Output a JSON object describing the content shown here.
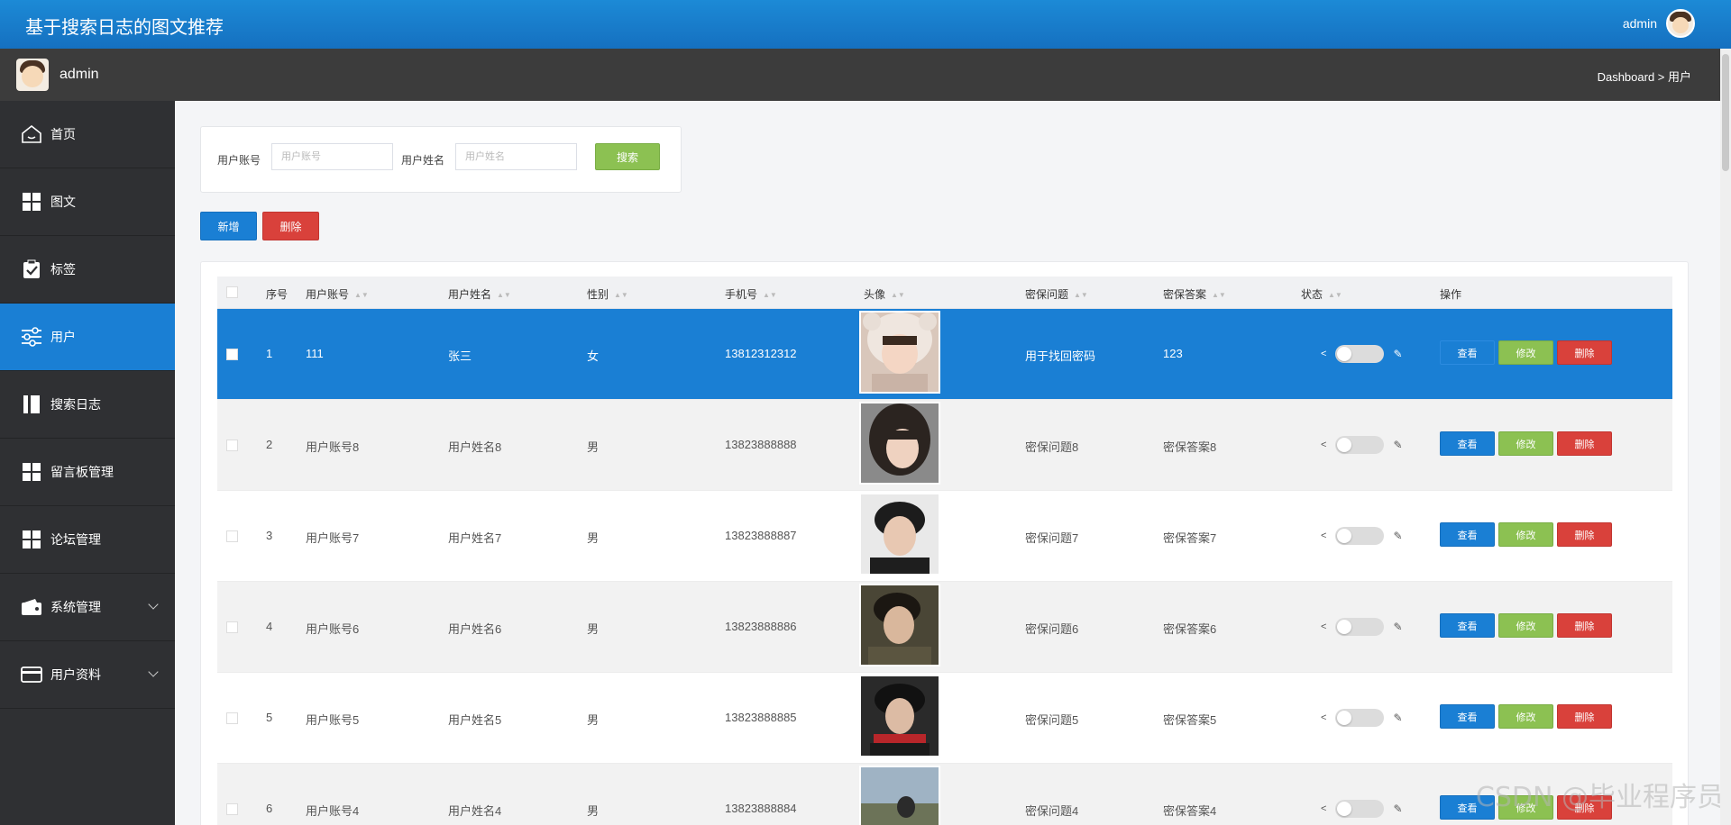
{
  "app": {
    "title": "基于搜索日志的图文推荐",
    "top_user": "admin"
  },
  "subbar": {
    "user": "admin",
    "breadcrumb": "Dashboard > 用户"
  },
  "sidebar": {
    "items": [
      {
        "label": "首页",
        "icon": "home-icon"
      },
      {
        "label": "图文",
        "icon": "grid-icon"
      },
      {
        "label": "标签",
        "icon": "clipboard-check-icon"
      },
      {
        "label": "用户",
        "icon": "sliders-icon",
        "active": true
      },
      {
        "label": "搜索日志",
        "icon": "book-icon"
      },
      {
        "label": "留言板管理",
        "icon": "grid-icon"
      },
      {
        "label": "论坛管理",
        "icon": "grid-icon"
      },
      {
        "label": "系统管理",
        "icon": "wallet-icon",
        "expandable": true
      },
      {
        "label": "用户资料",
        "icon": "card-icon",
        "expandable": true
      }
    ]
  },
  "search": {
    "account_label": "用户账号",
    "account_placeholder": "用户账号",
    "name_label": "用户姓名",
    "name_placeholder": "用户姓名",
    "button": "搜索"
  },
  "toolbar": {
    "add": "新增",
    "delete": "删除"
  },
  "table": {
    "columns": [
      "序号",
      "用户账号",
      "用户姓名",
      "性别",
      "手机号",
      "头像",
      "密保问题",
      "密保答案",
      "状态",
      "操作"
    ],
    "rows": [
      {
        "no": "1",
        "account": "111",
        "name": "张三",
        "gender": "女",
        "phone": "13812312312",
        "question": "用于找回密码",
        "answer": "123"
      },
      {
        "no": "2",
        "account": "用户账号8",
        "name": "用户姓名8",
        "gender": "男",
        "phone": "13823888888",
        "question": "密保问题8",
        "answer": "密保答案8"
      },
      {
        "no": "3",
        "account": "用户账号7",
        "name": "用户姓名7",
        "gender": "男",
        "phone": "13823888887",
        "question": "密保问题7",
        "answer": "密保答案7"
      },
      {
        "no": "4",
        "account": "用户账号6",
        "name": "用户姓名6",
        "gender": "男",
        "phone": "13823888886",
        "question": "密保问题6",
        "answer": "密保答案6"
      },
      {
        "no": "5",
        "account": "用户账号5",
        "name": "用户姓名5",
        "gender": "男",
        "phone": "13823888885",
        "question": "密保问题5",
        "answer": "密保答案5"
      },
      {
        "no": "6",
        "account": "用户账号4",
        "name": "用户姓名4",
        "gender": "男",
        "phone": "13823888884",
        "question": "密保问题4",
        "answer": "密保答案4"
      }
    ],
    "actions": {
      "view": "查看",
      "edit": "修改",
      "delete": "删除"
    }
  },
  "watermark": "CSDN @毕业程序员",
  "colors": {
    "primary": "#1a7fd4",
    "success": "#8cc152",
    "danger": "#d9413b",
    "sidebar": "#2f3033"
  }
}
